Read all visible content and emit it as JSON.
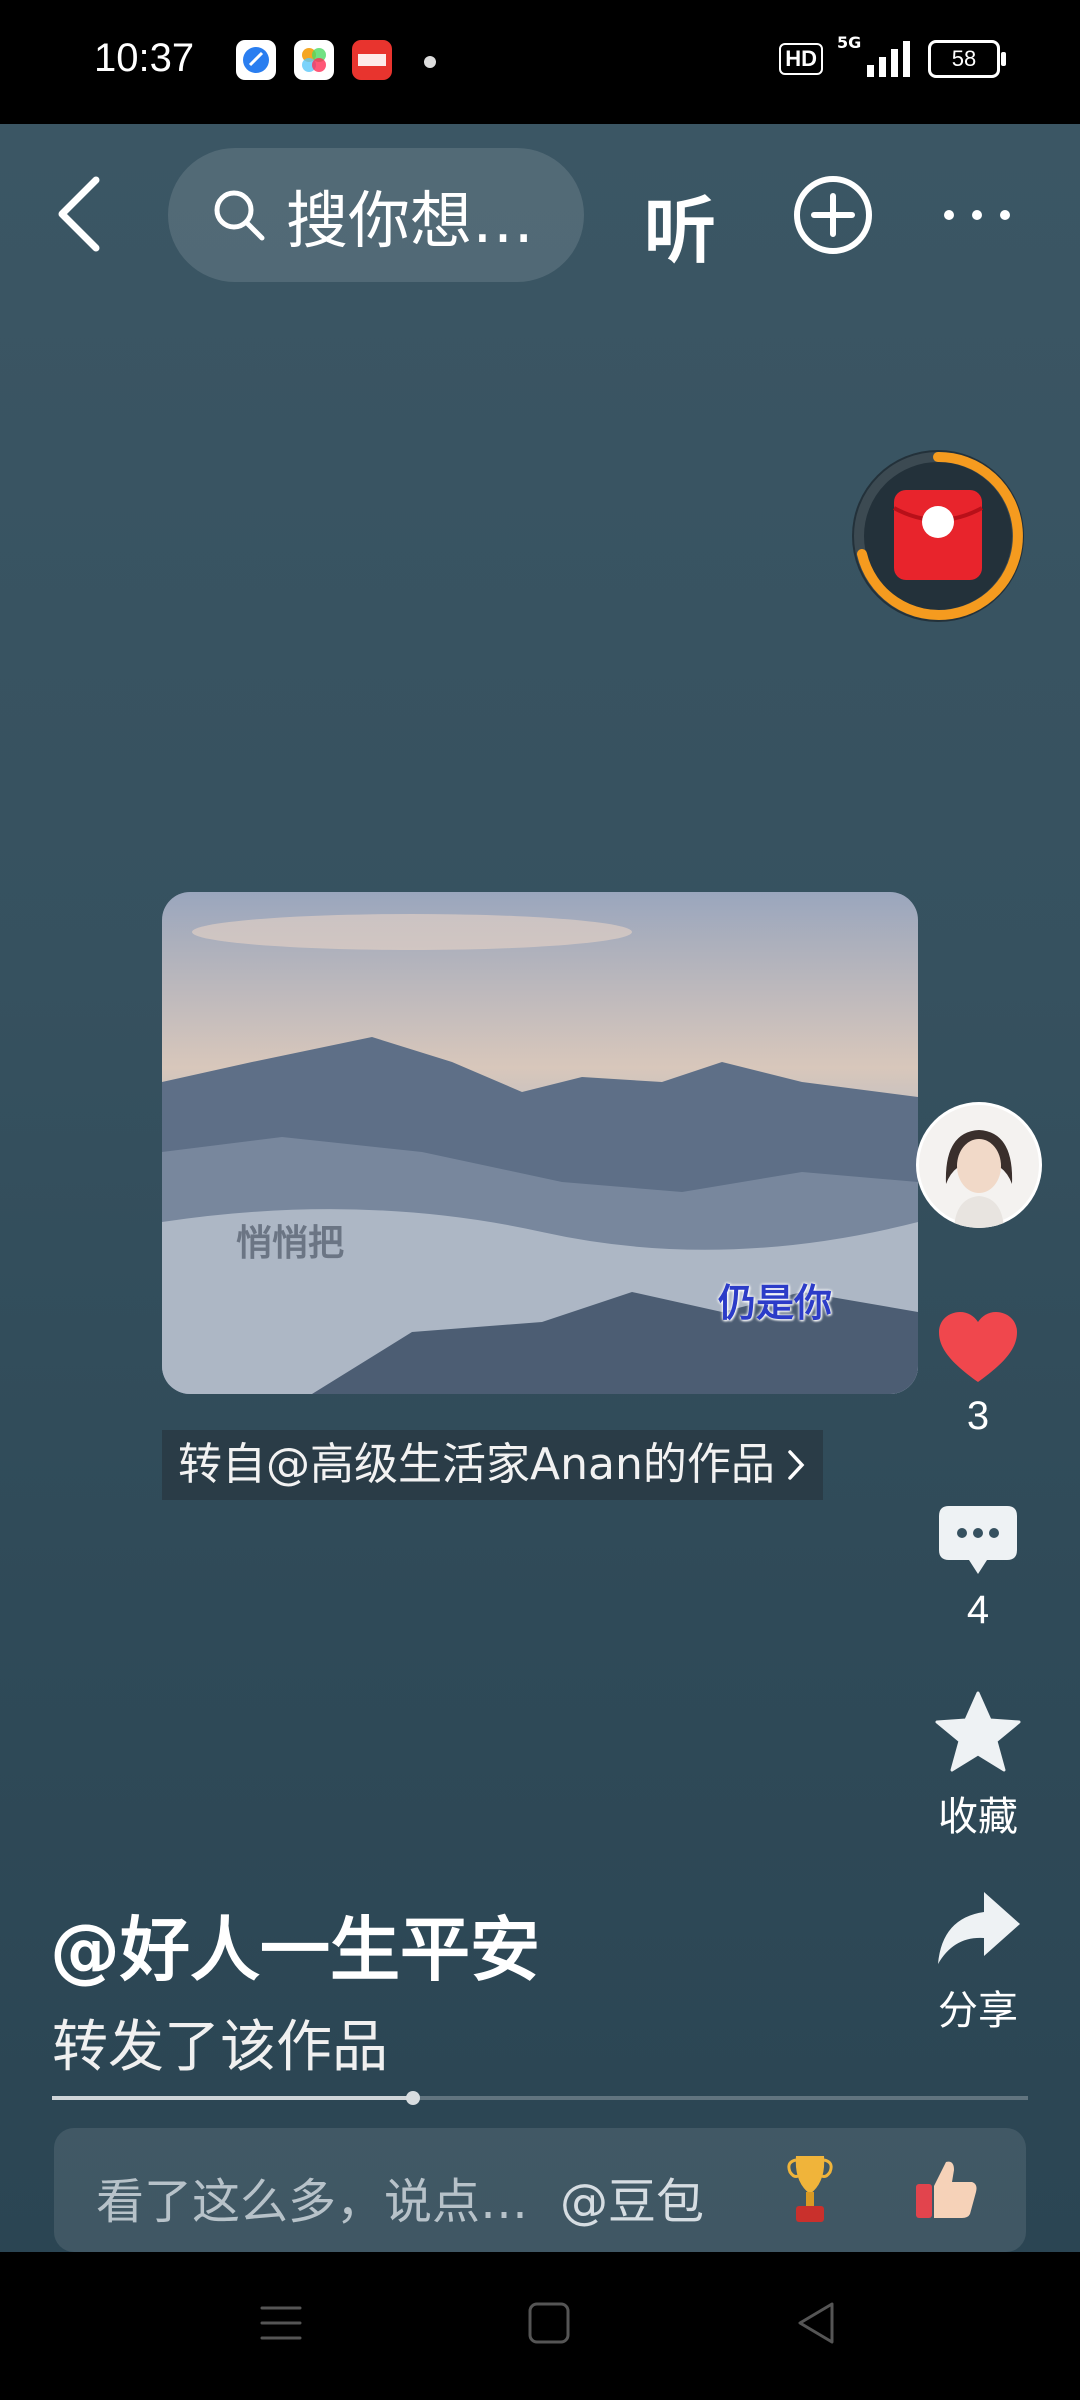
{
  "status_bar": {
    "time": "10:37",
    "network": "5G",
    "hd": "HD",
    "battery": "58"
  },
  "top_bar": {
    "search_placeholder": "搜你想…",
    "listen_label": "听"
  },
  "video": {
    "caption_left": "悄悄把",
    "caption_right": "仍是你",
    "source_text": "转自@高级生活家Anan的作品"
  },
  "rail": {
    "likes": "3",
    "comments": "4",
    "favorite_label": "收藏",
    "share_label": "分享"
  },
  "post": {
    "author": "@好人一生平安",
    "action": "转发了该作品",
    "progress": 0.37
  },
  "comment_bar": {
    "placeholder": "看了这么多，说点…",
    "mention": "@豆包"
  },
  "colors": {
    "like_red": "#f0474d",
    "ring_orange": "#f59b1f",
    "packet_red": "#e8242c"
  }
}
